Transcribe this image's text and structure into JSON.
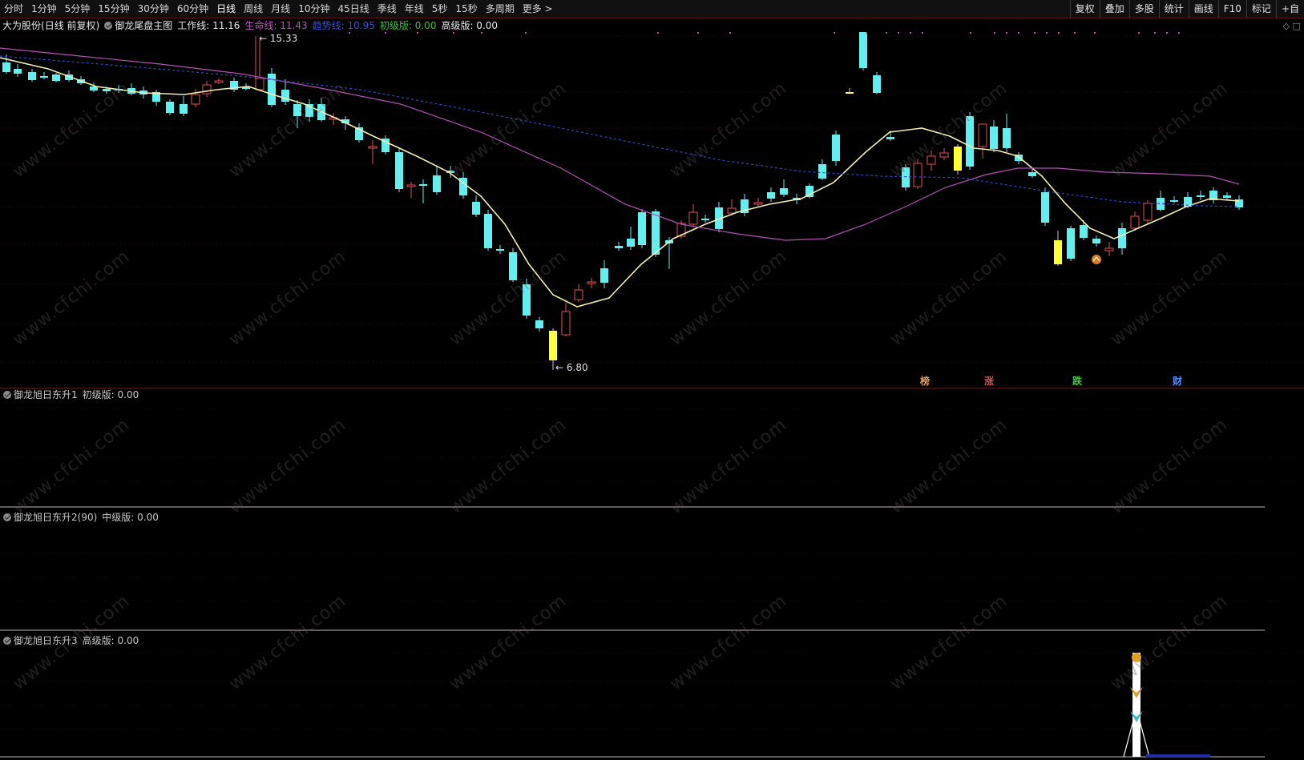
{
  "toolbar": {
    "tabs": [
      "分时",
      "1分钟",
      "5分钟",
      "15分钟",
      "30分钟",
      "60分钟",
      "日线",
      "周线",
      "月线",
      "10分钟",
      "45日线",
      "季线",
      "年线",
      "5秒",
      "15秒",
      "多周期",
      "更多 >"
    ],
    "tools": [
      "复权",
      "叠加",
      "多股",
      "统计",
      "画线",
      "F10",
      "标记",
      "+自"
    ]
  },
  "main": {
    "stock": "大为股份",
    "period": "(日线 前复权)",
    "indicator": "御龙尾盘主图",
    "work_line": "工作线: 11.16",
    "life_line": "生命线: 11.43",
    "trend_line": "趋势线: 10.95",
    "basic": "初级版: 0.00",
    "advanced": "高级版: 0.00",
    "high_label": "15.33",
    "low_label": "6.80",
    "signals": [
      "榜",
      "涨",
      "跌",
      "财"
    ],
    "colors": {
      "up": "#e05050",
      "down": "#5ff0f0",
      "work": "#f3eeb0",
      "life": "#b450b4",
      "trend": "#3246c8",
      "signal_bar": "#ffff32"
    }
  },
  "sub1": {
    "name": "御龙旭日东升1",
    "value": "初级版: 0.00"
  },
  "sub2": {
    "name": "御龙旭日东升2(90)",
    "value": "中级版: 0.00"
  },
  "sub3": {
    "name": "御龙旭日东升3",
    "value": "高级版: 0.00"
  },
  "watermark": "www.cfchi.com"
}
